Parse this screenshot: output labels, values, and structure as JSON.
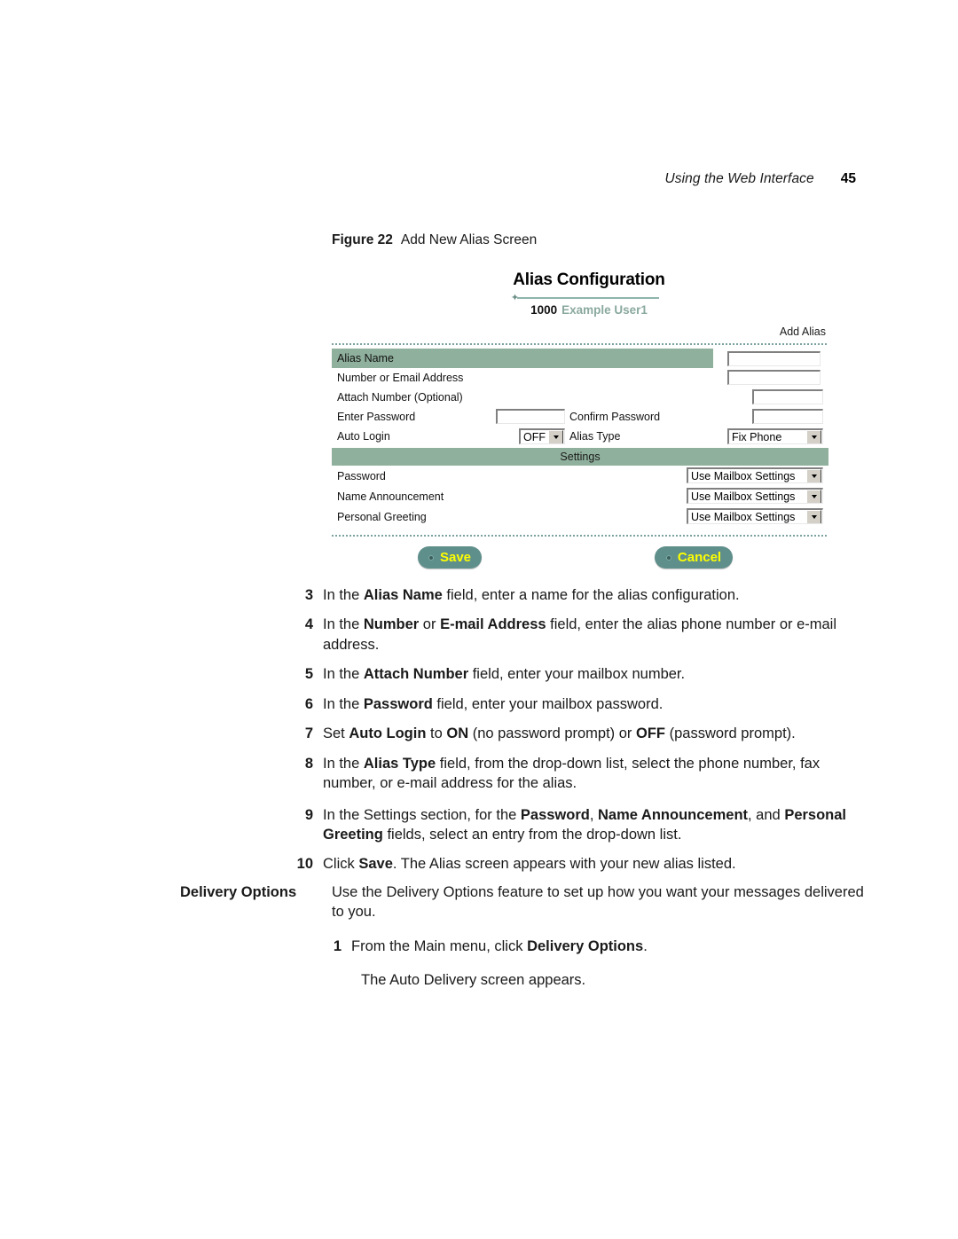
{
  "running_head": {
    "title": "Using the Web Interface",
    "page_number": "45"
  },
  "figure": {
    "label": "Figure 22",
    "caption": "Add New Alias Screen"
  },
  "screenshot": {
    "title": "Alias Configuration",
    "user_id": "1000",
    "user_name": "Example User1",
    "breadcrumb": "Add Alias",
    "rows": [
      {
        "label": "Alias Name",
        "highlighted": true
      },
      {
        "label": "Number or Email Address",
        "highlighted": false
      },
      {
        "label": "Attach Number (Optional)",
        "highlighted": false
      },
      {
        "label": "Enter Password",
        "highlighted": false
      },
      {
        "label": "Confirm Password",
        "highlighted": false
      },
      {
        "label": "Auto Login",
        "highlighted": false
      },
      {
        "label": "Alias Type",
        "highlighted": false
      }
    ],
    "fields": {
      "alias_name_value": "",
      "number_or_email_value": "",
      "attach_number_value": "",
      "enter_password_value": "",
      "confirm_password_value": "",
      "auto_login_value": "OFF",
      "alias_type_value": "Fix Phone"
    },
    "settings_section": {
      "heading": "Settings",
      "rows": [
        {
          "label": "Password",
          "value": "Use Mailbox Settings"
        },
        {
          "label": "Name Announcement",
          "value": "Use Mailbox Settings"
        },
        {
          "label": "Personal Greeting",
          "value": "Use Mailbox Settings"
        }
      ]
    },
    "buttons": {
      "save": "Save",
      "cancel": "Cancel"
    },
    "colors": {
      "band_green": "#8fb09c",
      "rule_teal": "#8fb4ac",
      "button_teal": "#5f8f8b",
      "button_text_yellow": "#ffff00",
      "user_name_green": "#8aa99e"
    }
  },
  "steps": [
    {
      "num": "3",
      "parts": [
        {
          "t": "In the ",
          "b": false
        },
        {
          "t": "Alias Name",
          "b": true
        },
        {
          "t": " field, enter a name for the alias configuration.",
          "b": false
        }
      ]
    },
    {
      "num": "4",
      "parts": [
        {
          "t": "In the ",
          "b": false
        },
        {
          "t": "Number",
          "b": true
        },
        {
          "t": " or ",
          "b": false
        },
        {
          "t": "E-mail Address",
          "b": true
        },
        {
          "t": " field, enter the alias phone number or e-mail address.",
          "b": false
        }
      ]
    },
    {
      "num": "5",
      "parts": [
        {
          "t": "In the ",
          "b": false
        },
        {
          "t": "Attach Number",
          "b": true
        },
        {
          "t": " field, enter your mailbox number.",
          "b": false
        }
      ]
    },
    {
      "num": "6",
      "parts": [
        {
          "t": "In the ",
          "b": false
        },
        {
          "t": "Password",
          "b": true
        },
        {
          "t": " field, enter your mailbox password.",
          "b": false
        }
      ]
    },
    {
      "num": "7",
      "parts": [
        {
          "t": "Set ",
          "b": false
        },
        {
          "t": "Auto Login",
          "b": true
        },
        {
          "t": " to ",
          "b": false
        },
        {
          "t": "ON",
          "b": true
        },
        {
          "t": " (no password prompt) or ",
          "b": false
        },
        {
          "t": "OFF",
          "b": true
        },
        {
          "t": " (password prompt).",
          "b": false
        }
      ]
    },
    {
      "num": "8",
      "parts": [
        {
          "t": "In the ",
          "b": false
        },
        {
          "t": "Alias Type",
          "b": true
        },
        {
          "t": " field, from the drop-down list, select the phone number, fax number, or e-mail address for the alias.",
          "b": false
        }
      ]
    },
    {
      "num": "9",
      "parts": [
        {
          "t": "In the Settings section, for the ",
          "b": false
        },
        {
          "t": "Password",
          "b": true
        },
        {
          "t": ", ",
          "b": false
        },
        {
          "t": "Name Announcement",
          "b": true
        },
        {
          "t": ", and ",
          "b": false
        },
        {
          "t": "Personal Greeting",
          "b": true
        },
        {
          "t": " fields, select an entry from the drop-down list.",
          "b": false
        }
      ]
    },
    {
      "num": "10",
      "parts": [
        {
          "t": "Click ",
          "b": false
        },
        {
          "t": "Save",
          "b": true
        },
        {
          "t": ". The Alias screen appears with your new alias listed.",
          "b": false
        }
      ]
    }
  ],
  "delivery": {
    "heading": "Delivery Options",
    "intro": "Use the Delivery Options feature to set up how you want your messages delivered to you.",
    "step": {
      "num": "1",
      "parts": [
        {
          "t": "From the Main menu, click ",
          "b": false
        },
        {
          "t": "Delivery Options",
          "b": true
        },
        {
          "t": ".",
          "b": false
        }
      ]
    },
    "result": "The Auto Delivery screen appears."
  }
}
